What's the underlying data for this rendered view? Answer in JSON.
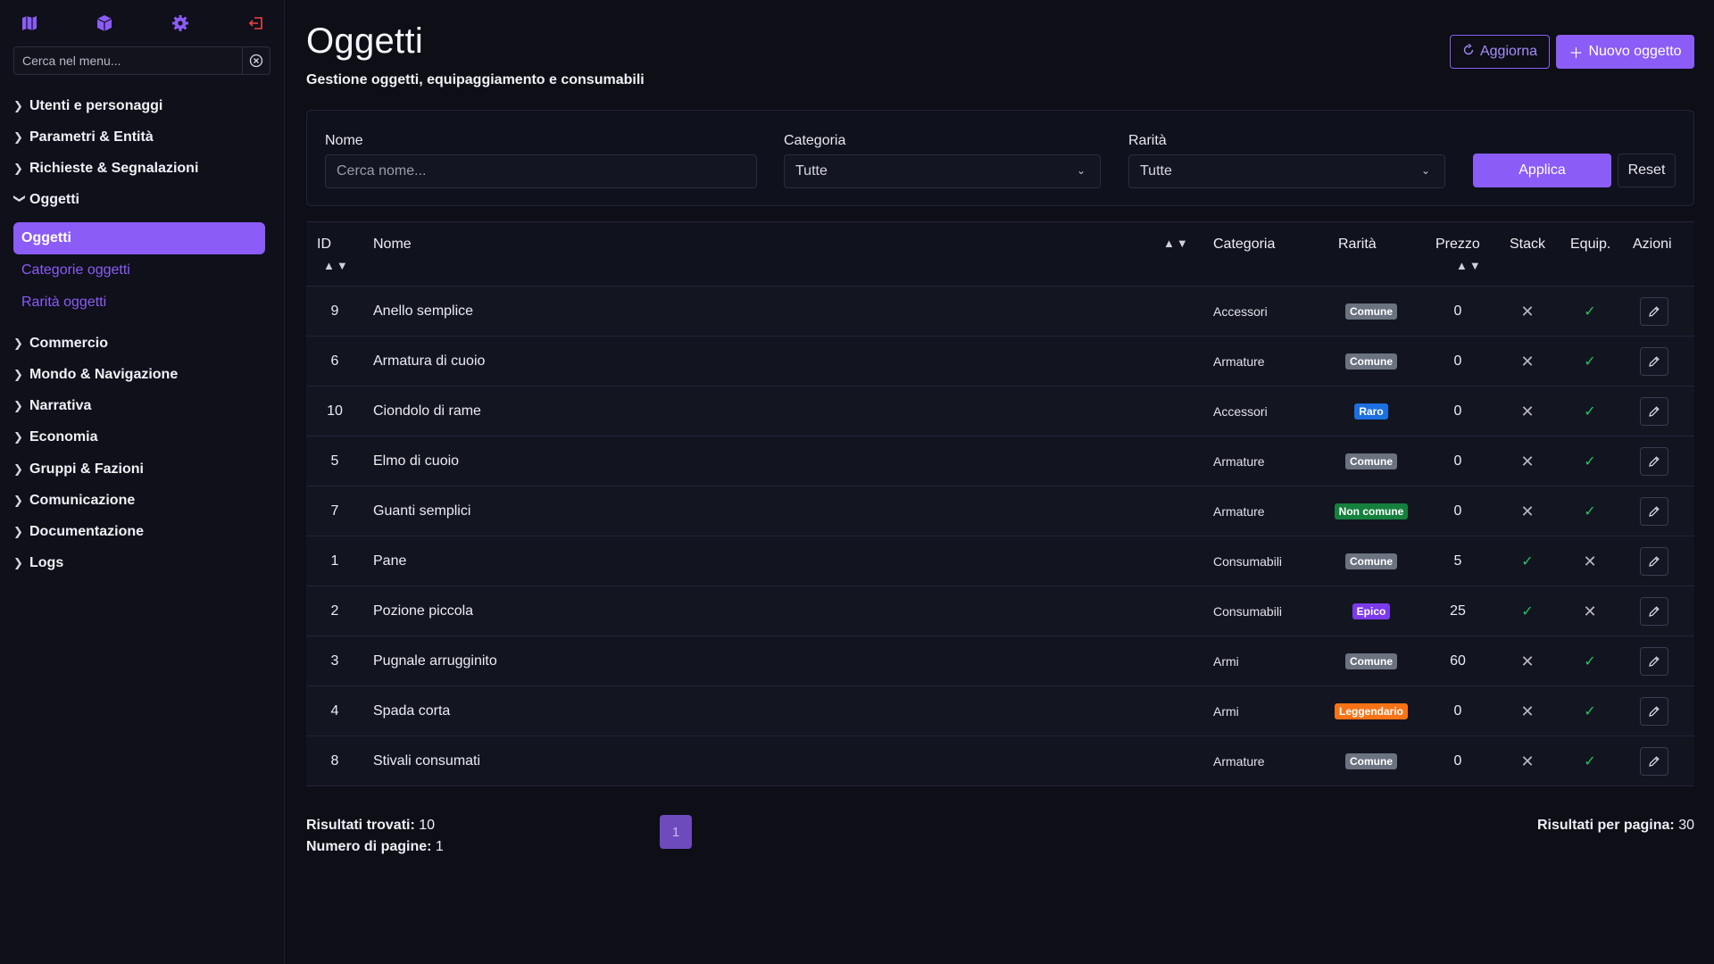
{
  "sidebar": {
    "icons": [
      "map-icon",
      "cube-icon",
      "gear-icon",
      "logout-icon"
    ],
    "search_placeholder": "Cerca nel menu...",
    "groups": [
      {
        "label": "Utenti e personaggi"
      },
      {
        "label": "Parametri & Entità"
      },
      {
        "label": "Richieste & Segnalazioni"
      },
      {
        "label": "Oggetti",
        "expanded": true
      },
      {
        "label": "Commercio"
      },
      {
        "label": "Mondo & Navigazione"
      },
      {
        "label": "Narrativa"
      },
      {
        "label": "Economia"
      },
      {
        "label": "Gruppi & Fazioni"
      },
      {
        "label": "Comunicazione"
      },
      {
        "label": "Documentazione"
      },
      {
        "label": "Logs"
      }
    ],
    "active_item": "Oggetti",
    "sub_items": [
      "Categorie oggetti",
      "Rarità oggetti"
    ]
  },
  "header": {
    "title": "Oggetti",
    "subtitle": "Gestione oggetti, equipaggiamento e consumabili",
    "refresh_label": "Aggiorna",
    "new_label": "Nuovo oggetto"
  },
  "filters": {
    "name_label": "Nome",
    "name_placeholder": "Cerca nome...",
    "category_label": "Categoria",
    "category_value": "Tutte",
    "rarity_label": "Rarità",
    "rarity_value": "Tutte",
    "apply_label": "Applica",
    "reset_label": "Reset"
  },
  "table": {
    "headers": {
      "id": "ID",
      "name": "Nome",
      "category": "Categoria",
      "rarity": "Rarità",
      "price": "Prezzo",
      "stack": "Stack",
      "equip": "Equip.",
      "actions": "Azioni"
    },
    "rows": [
      {
        "id": "9",
        "name": "Anello semplice",
        "category": "Accessori",
        "rarity": "Comune",
        "price": "0",
        "stack": false,
        "equip": true
      },
      {
        "id": "6",
        "name": "Armatura di cuoio",
        "category": "Armature",
        "rarity": "Comune",
        "price": "0",
        "stack": false,
        "equip": true
      },
      {
        "id": "10",
        "name": "Ciondolo di rame",
        "category": "Accessori",
        "rarity": "Raro",
        "price": "0",
        "stack": false,
        "equip": true
      },
      {
        "id": "5",
        "name": "Elmo di cuoio",
        "category": "Armature",
        "rarity": "Comune",
        "price": "0",
        "stack": false,
        "equip": true
      },
      {
        "id": "7",
        "name": "Guanti semplici",
        "category": "Armature",
        "rarity": "Non comune",
        "price": "0",
        "stack": false,
        "equip": true
      },
      {
        "id": "1",
        "name": "Pane",
        "category": "Consumabili",
        "rarity": "Comune",
        "price": "5",
        "stack": true,
        "equip": false
      },
      {
        "id": "2",
        "name": "Pozione piccola",
        "category": "Consumabili",
        "rarity": "Epico",
        "price": "25",
        "stack": true,
        "equip": false
      },
      {
        "id": "3",
        "name": "Pugnale arrugginito",
        "category": "Armi",
        "rarity": "Comune",
        "price": "60",
        "stack": false,
        "equip": true
      },
      {
        "id": "4",
        "name": "Spada corta",
        "category": "Armi",
        "rarity": "Leggendario",
        "price": "0",
        "stack": false,
        "equip": true
      },
      {
        "id": "8",
        "name": "Stivali consumati",
        "category": "Armature",
        "rarity": "Comune",
        "price": "0",
        "stack": false,
        "equip": true
      }
    ]
  },
  "rarity_colors": {
    "Comune": "#6b7280",
    "Raro": "#1d6fe0",
    "Non comune": "#15803d",
    "Epico": "#7c3aed",
    "Leggendario": "#f97316"
  },
  "footer": {
    "results_label": "Risultati trovati:",
    "results_value": "10",
    "pages_label": "Numero di pagine:",
    "pages_value": "1",
    "current_page": "1",
    "per_page_label": "Risultati per pagina:",
    "per_page_value": "30"
  },
  "colors": {
    "accent": "#8b5cf6",
    "check": "#22c55e",
    "logout": "#ef4444"
  }
}
